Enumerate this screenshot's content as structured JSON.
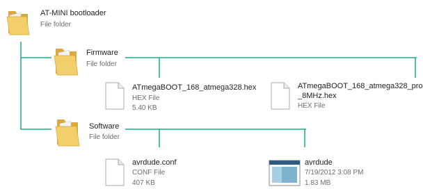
{
  "colors": {
    "connector": "#1fa58f",
    "text": "#1e1e1e",
    "meta": "#6d6d6d"
  },
  "root": {
    "name": "AT-MINI bootloader",
    "type": "File folder",
    "icon": "folder-icon"
  },
  "firmware": {
    "name": "Firmware",
    "type": "File folder",
    "icon": "folder-icon",
    "files": [
      {
        "name": "ATmegaBOOT_168_atmega328.hex",
        "type": "HEX File",
        "size": "5.40 KB",
        "icon": "document-icon"
      },
      {
        "name_line1": "ATmegaBOOT_168_atmega328_pro",
        "name_line2": "_8MHz.hex",
        "type": "HEX File",
        "icon": "document-icon"
      }
    ]
  },
  "software": {
    "name": "Software",
    "type": "File folder",
    "icon": "folder-icon",
    "files": [
      {
        "name": "avrdude.conf",
        "type": "CONF File",
        "size": "407 KB",
        "icon": "document-icon"
      },
      {
        "name": "avrdude",
        "date": "7/19/2012 3:08 PM",
        "size": "1.83 MB",
        "icon": "application-icon"
      }
    ]
  }
}
